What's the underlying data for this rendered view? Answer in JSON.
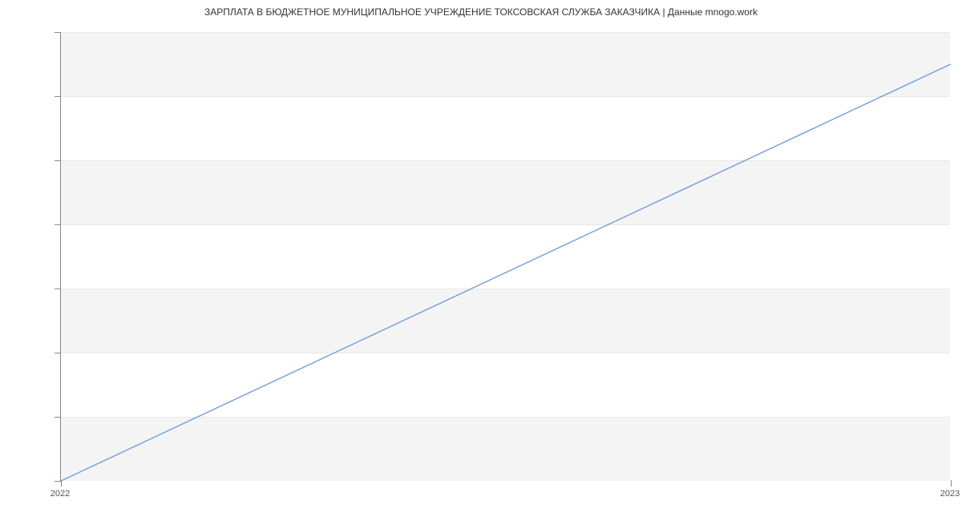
{
  "chart_data": {
    "type": "line",
    "title": "ЗАРПЛАТА В БЮДЖЕТНОЕ МУНИЦИПАЛЬНОЕ УЧРЕЖДЕНИЕ ТОКСОВСКАЯ СЛУЖБА ЗАКАЗЧИКА | Данные mnogo.work",
    "x": [
      2022,
      2023
    ],
    "values": [
      32000,
      45000
    ],
    "xlabel": "",
    "ylabel": "",
    "ylim": [
      32000,
      46000
    ],
    "y_ticks": [
      32000,
      34000,
      36000,
      38000,
      40000,
      42000,
      44000,
      46000
    ],
    "x_ticks": [
      2022,
      2023
    ],
    "line_color": "#6f9ddc",
    "bands": [
      {
        "from": 32000,
        "to": 34000
      },
      {
        "from": 36000,
        "to": 38000
      },
      {
        "from": 40000,
        "to": 42000
      },
      {
        "from": 44000,
        "to": 46000
      }
    ]
  }
}
